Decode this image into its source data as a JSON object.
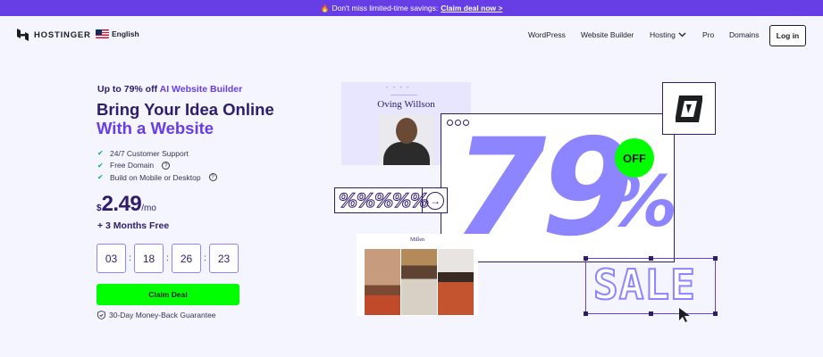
{
  "promo": {
    "icon": "fire-icon",
    "text": "Don't miss limited-time savings:",
    "link": "Claim deal now >"
  },
  "nav": {
    "logo": "HOSTINGER",
    "language": "English",
    "items": [
      "WordPress",
      "Website Builder",
      "Hosting",
      "Pro",
      "Domains"
    ],
    "login": "Log in"
  },
  "hero": {
    "subtitle_prefix": "Up to 79% off",
    "subtitle_accent": "AI Website Builder",
    "headline_line1": "Bring Your Idea Online",
    "headline_line2": "With a Website",
    "features": [
      "24/7 Customer Support",
      "Free Domain",
      "Build on Mobile or Desktop"
    ],
    "price_currency": "$",
    "price_amount": "2.49",
    "price_period": "/mo",
    "bonus": "+ 3 Months Free",
    "timer": [
      "03",
      "18",
      "26",
      "23"
    ],
    "cta": "Claim Deal",
    "guarantee": "30-Day Money-Back Guarantee"
  },
  "visual": {
    "card1_name": "Oving Willson",
    "big_number": "79",
    "percent": "%",
    "off_badge": "OFF",
    "percent_strip": "%%%%%",
    "card2_title": "Millen",
    "sale": "SALE"
  },
  "colors": {
    "brand": "#673de6",
    "dark": "#2f1c6a",
    "accent_green": "#00ff00",
    "lavender": "#8c85ff",
    "background": "#f4f5ff"
  }
}
